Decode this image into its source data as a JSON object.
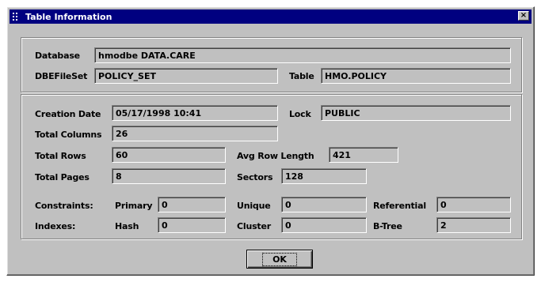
{
  "window": {
    "title": "Table Information",
    "close_glyph": "×"
  },
  "section1": {
    "database_label": "Database",
    "database_value": "hmodbe DATA.CARE",
    "dbefileset_label": "DBEFileSet",
    "dbefileset_value": "POLICY_SET",
    "table_label": "Table",
    "table_value": "HMO.POLICY"
  },
  "section2": {
    "creation_date_label": "Creation Date",
    "creation_date_value": "05/17/1998 10:41",
    "lock_label": "Lock",
    "lock_value": "PUBLIC",
    "total_columns_label": "Total Columns",
    "total_columns_value": "26",
    "total_rows_label": "Total Rows",
    "total_rows_value": "60",
    "avg_row_length_label": "Avg Row Length",
    "avg_row_length_value": "421",
    "total_pages_label": "Total Pages",
    "total_pages_value": "8",
    "sectors_label": "Sectors",
    "sectors_value": "128",
    "constraints_label": "Constraints:",
    "primary_label": "Primary",
    "primary_value": "0",
    "unique_label": "Unique",
    "unique_value": "0",
    "referential_label": "Referential",
    "referential_value": "0",
    "indexes_label": "Indexes:",
    "hash_label": "Hash",
    "hash_value": "0",
    "cluster_label": "Cluster",
    "cluster_value": "0",
    "btree_label": "B-Tree",
    "btree_value": "2"
  },
  "buttons": {
    "ok_label": "OK"
  }
}
